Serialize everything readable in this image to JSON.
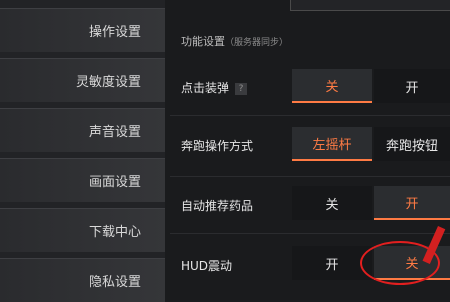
{
  "sidebar": {
    "items": [
      {
        "label": "操作设置"
      },
      {
        "label": "灵敏度设置"
      },
      {
        "label": "声音设置"
      },
      {
        "label": "画面设置"
      },
      {
        "label": "下载中心"
      },
      {
        "label": "隐私设置"
      }
    ]
  },
  "section": {
    "title": "功能设置",
    "subtitle": "（服务器同步）"
  },
  "rows": [
    {
      "label": "点击装弹",
      "help": "?",
      "options": [
        "关",
        "开"
      ],
      "selected": "关"
    },
    {
      "label": "奔跑操作方式",
      "options": [
        "左摇杆",
        "奔跑按钮"
      ],
      "selected": "左摇杆"
    },
    {
      "label": "自动推荐药品",
      "options": [
        "关",
        "开"
      ],
      "selected": "开"
    },
    {
      "label": "HUD震动",
      "options": [
        "开",
        "关"
      ],
      "selected": "关"
    }
  ],
  "colors": {
    "accent": "#ff7b44",
    "annotation": "#e21f1f",
    "background": "#1a1b1d"
  }
}
